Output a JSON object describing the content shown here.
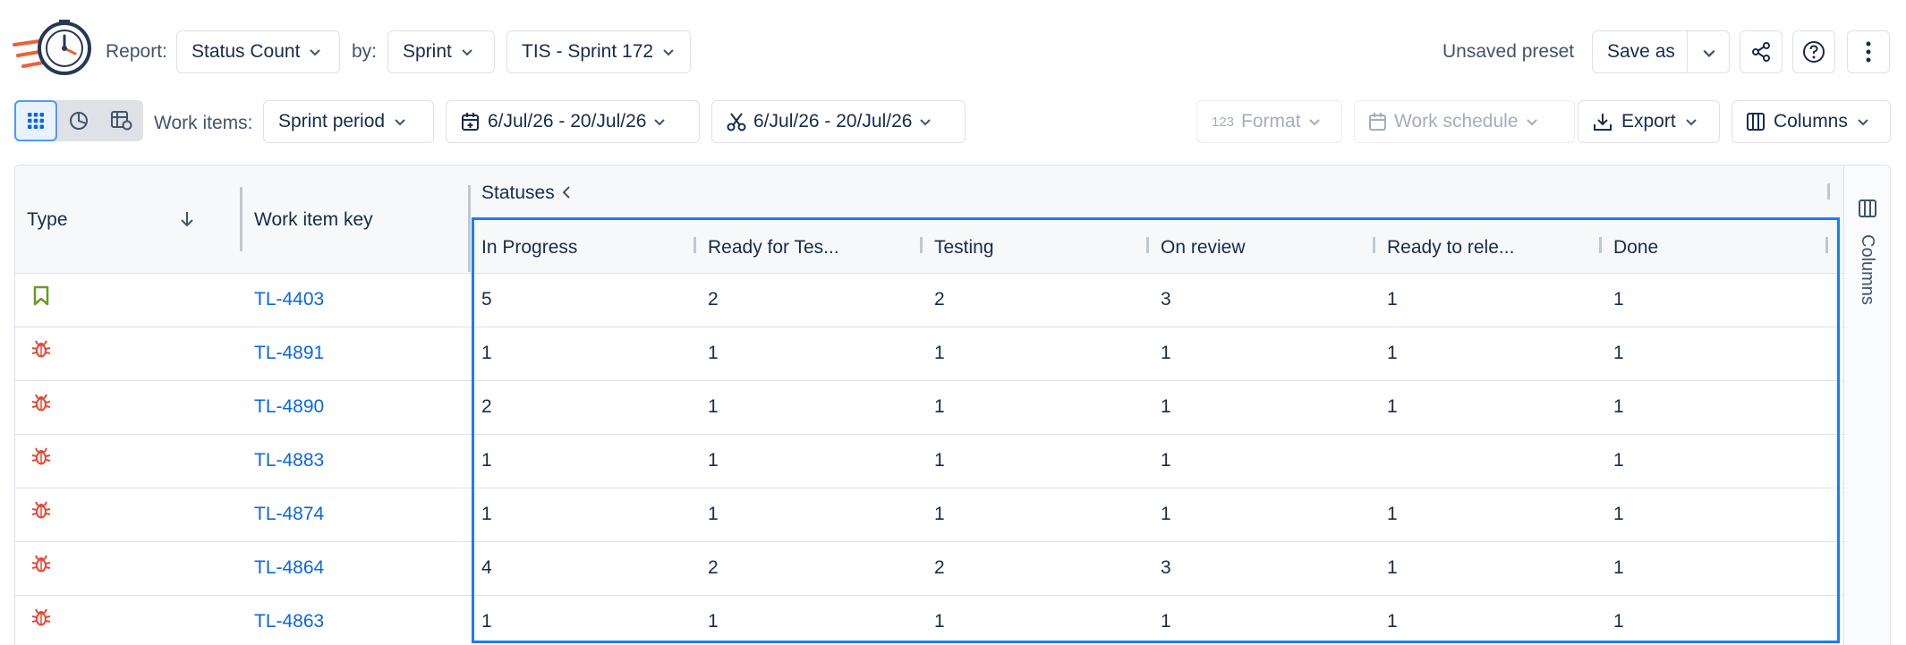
{
  "toolbar": {
    "report_label": "Report:",
    "report_value": "Status Count",
    "by_label": "by:",
    "by_value": "Sprint",
    "sprint_value": "TIS - Sprint 172",
    "preset_status": "Unsaved preset",
    "save_as_label": "Save as"
  },
  "filters": {
    "work_items_label": "Work items:",
    "period_value": "Sprint period",
    "date_range_1": "6/Jul/26 - 20/Jul/26",
    "date_range_2": "6/Jul/26 - 20/Jul/26",
    "format_label": "Format",
    "format_prefix": "123",
    "work_schedule_label": "Work schedule",
    "export_label": "Export",
    "columns_label": "Columns"
  },
  "table": {
    "type_header": "Type",
    "key_header": "Work item key",
    "group_header": "Statuses",
    "status_headers": [
      "In Progress",
      "Ready for Tes...",
      "Testing",
      "On review",
      "Ready to rele...",
      "Done"
    ],
    "side_panel_label": "Columns",
    "rows": [
      {
        "type": "story",
        "key": "TL-4403",
        "values": [
          "5",
          "2",
          "2",
          "3",
          "1",
          "1"
        ]
      },
      {
        "type": "bug",
        "key": "TL-4891",
        "values": [
          "1",
          "1",
          "1",
          "1",
          "1",
          "1"
        ]
      },
      {
        "type": "bug",
        "key": "TL-4890",
        "values": [
          "2",
          "1",
          "1",
          "1",
          "1",
          "1"
        ]
      },
      {
        "type": "bug",
        "key": "TL-4883",
        "values": [
          "1",
          "1",
          "1",
          "1",
          "",
          "1"
        ]
      },
      {
        "type": "bug",
        "key": "TL-4874",
        "values": [
          "1",
          "1",
          "1",
          "1",
          "1",
          "1"
        ]
      },
      {
        "type": "bug",
        "key": "TL-4864",
        "values": [
          "4",
          "2",
          "2",
          "3",
          "1",
          "1"
        ]
      },
      {
        "type": "bug",
        "key": "TL-4863",
        "values": [
          "1",
          "1",
          "1",
          "1",
          "1",
          "1"
        ]
      }
    ]
  },
  "colors": {
    "accent": "#1d7afc",
    "link": "#0c66e4",
    "bug": "#e34935",
    "story": "#6a9a23"
  }
}
